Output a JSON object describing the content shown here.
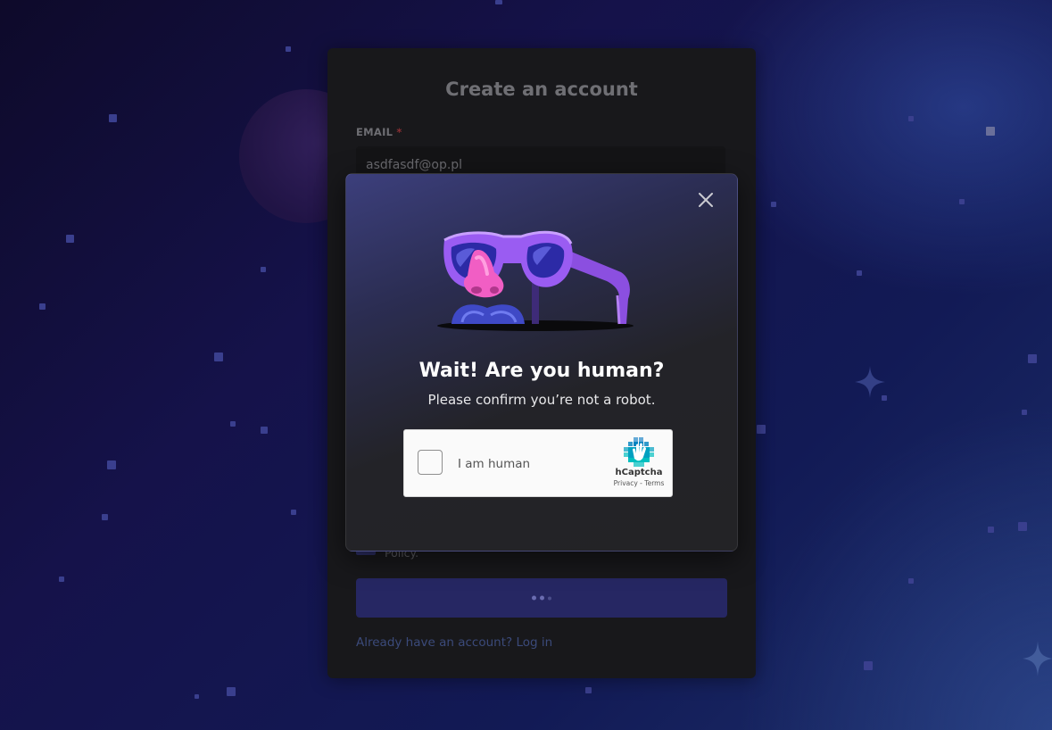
{
  "register": {
    "title": "Create an account",
    "email_label": "EMAIL",
    "email_required": "*",
    "email_value": "asdfasdf@op.pl",
    "policy_text": "Policy.",
    "login_text": "Already have an account? Log in"
  },
  "modal": {
    "title": "Wait! Are you human?",
    "subtitle": "Please confirm you’re not a robot.",
    "close_icon": "close-icon",
    "illustration_icon": "glasses-nose-disguise-icon"
  },
  "captcha": {
    "label": "I am human",
    "brand": "hCaptcha",
    "links": "Privacy - Terms",
    "checked": false
  },
  "colors": {
    "accent": "#5865f2",
    "modal_bg": "#232326",
    "captcha_accent": "#0074bf"
  }
}
